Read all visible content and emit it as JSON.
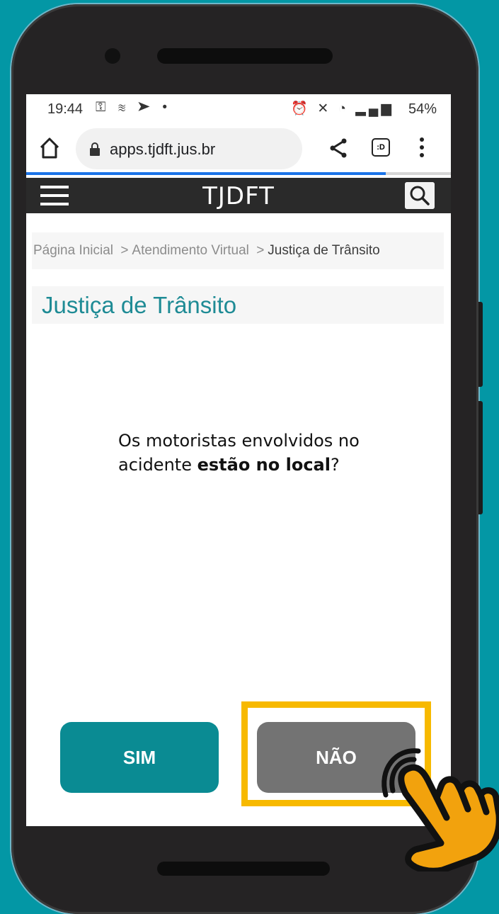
{
  "status_bar": {
    "time": "19:44",
    "battery": "54%"
  },
  "browser": {
    "url": "apps.tjdft.jus.br",
    "tabs_count": ":D"
  },
  "site_header": {
    "logo": "TJDFT"
  },
  "breadcrumb": {
    "items": [
      "Página Inicial",
      "Atendimento Virtual",
      "Justiça de Trânsito"
    ],
    "separator": ">"
  },
  "page": {
    "title": "Justiça de Trânsito",
    "question_part1": "Os motoristas envolvidos no acidente ",
    "question_bold": "estão no local",
    "question_end": "?"
  },
  "actions": {
    "yes_label": "SIM",
    "no_label": "NÃO"
  },
  "colors": {
    "background": "#0397a5",
    "accent": "#0a8b93",
    "highlight": "#f7b900",
    "no_button": "#737373"
  },
  "icons": [
    "home-icon",
    "lock-icon",
    "share-icon",
    "tabs-icon",
    "more-menu-icon",
    "hamburger-menu-icon",
    "search-icon",
    "pointing-hand-icon"
  ]
}
